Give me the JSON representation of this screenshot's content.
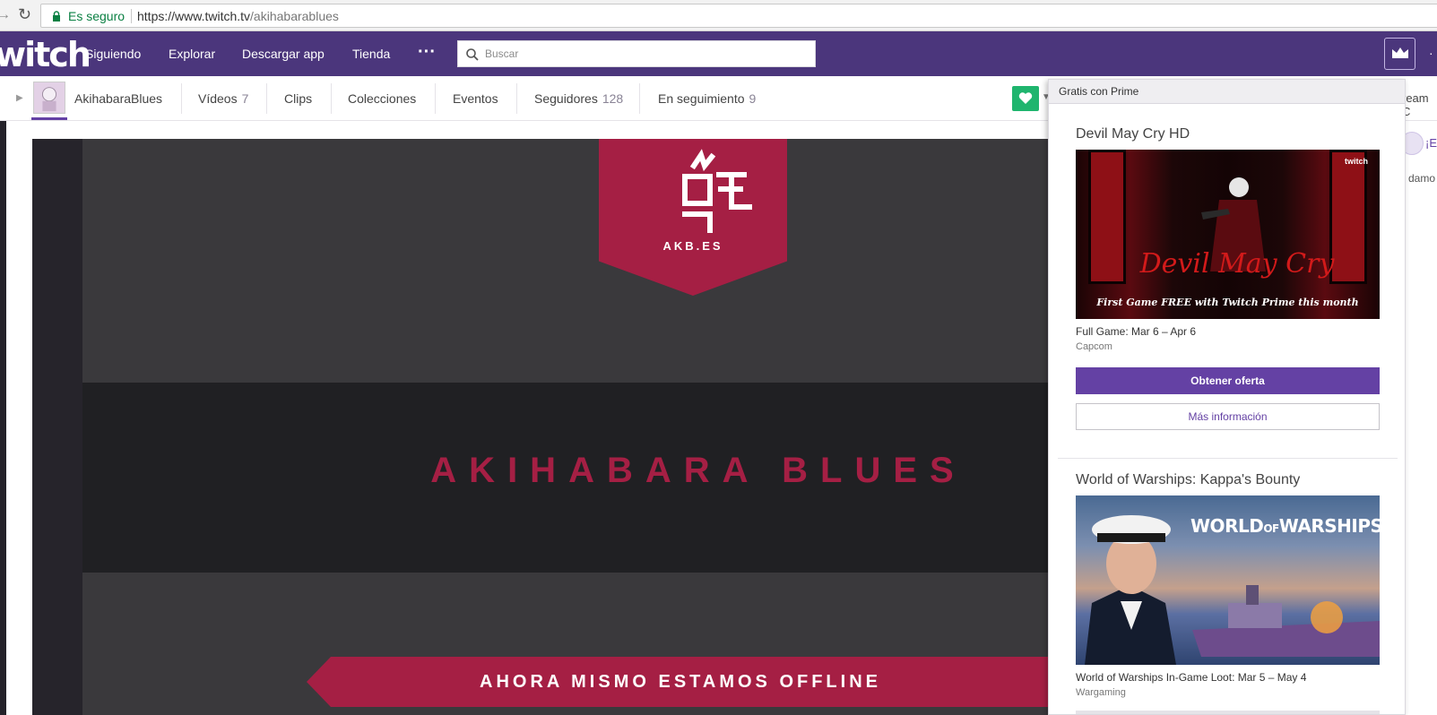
{
  "browser": {
    "secure_label": "Es seguro",
    "url_main": "https://www.twitch.tv",
    "url_path": "/akihabarablues"
  },
  "topnav": {
    "logo": "witch",
    "links": [
      "Siguiendo",
      "Explorar",
      "Descargar app",
      "Tienda"
    ],
    "more": "···",
    "search_placeholder": "Buscar"
  },
  "channel": {
    "name": "AkihabaraBlues",
    "tabs": [
      {
        "label": "Vídeos",
        "count": "7"
      },
      {
        "label": "Clips",
        "count": ""
      },
      {
        "label": "Colecciones",
        "count": ""
      },
      {
        "label": "Eventos",
        "count": ""
      },
      {
        "label": "Seguidores",
        "count": "128"
      },
      {
        "label": "En seguimiento",
        "count": "9"
      }
    ],
    "stream_peek": "ream C"
  },
  "video": {
    "badge_text": "AKB.ES",
    "brand_title": "AKIHABARA BLUES",
    "offline_text": "AHORA MISMO ESTAMOS OFFLINE"
  },
  "side_peek": {
    "text1": "¡Er",
    "text2": "damo"
  },
  "prime_panel": {
    "header": "Gratis con Prime",
    "offers": [
      {
        "title": "Devil May Cry HD",
        "image_logo": "Devil May Cry",
        "image_caption": "First Game FREE with Twitch Prime this month",
        "image_badge": "twitch",
        "desc": "Full Game: Mar 6 – Apr 6",
        "publisher": "Capcom",
        "primary_button": "Obtener oferta",
        "secondary_button": "Más información"
      },
      {
        "title": "World of Warships: Kappa's Bounty",
        "image_logo_a": "WORLD",
        "image_logo_b": "OF",
        "image_logo_c": "WARSHIPS",
        "desc": "World of Warships In-Game Loot: Mar 5 – May 4",
        "publisher": "Wargaming"
      }
    ]
  },
  "colors": {
    "twitch_purple": "#4b367c",
    "button_purple": "#6441a4",
    "follow_green": "#1fb56e",
    "brand_red": "#a51f44"
  }
}
